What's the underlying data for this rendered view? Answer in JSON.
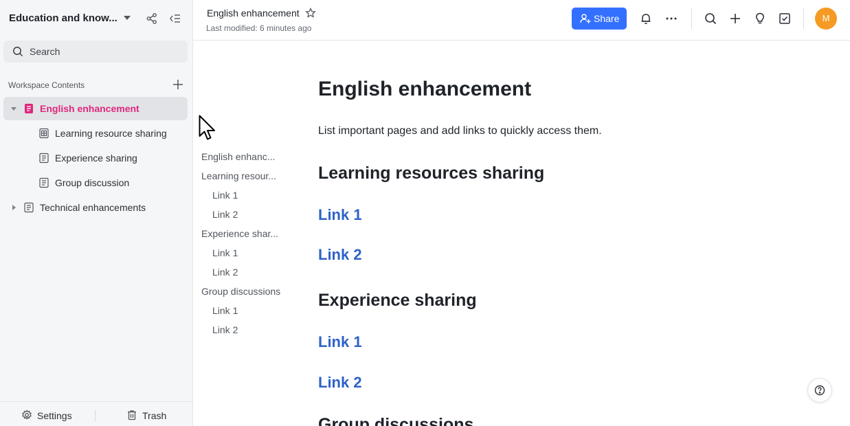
{
  "sidebar": {
    "workspace_title": "Education and know...",
    "search_placeholder": "Search",
    "section_label": "Workspace Contents",
    "items": [
      {
        "label": "English enhancement",
        "active": true
      },
      {
        "label": "Learning resource sharing"
      },
      {
        "label": "Experience sharing"
      },
      {
        "label": "Group discussion"
      },
      {
        "label": "Technical enhancements"
      }
    ],
    "footer": {
      "settings": "Settings",
      "trash": "Trash"
    }
  },
  "topbar": {
    "doc_title": "English enhancement",
    "last_modified": "Last modified: 6 minutes ago",
    "share_label": "Share",
    "avatar_initial": "M"
  },
  "outline": [
    {
      "label": "English enhanc..."
    },
    {
      "label": "Learning resour..."
    },
    {
      "label": "Link 1"
    },
    {
      "label": "Link 2"
    },
    {
      "label": "Experience shar..."
    },
    {
      "label": "Link 1"
    },
    {
      "label": "Link 2"
    },
    {
      "label": "Group discussions"
    },
    {
      "label": "Link 1"
    },
    {
      "label": "Link 2"
    }
  ],
  "document": {
    "title": "English enhancement",
    "intro": "List important pages and add links to quickly access them.",
    "sections": [
      {
        "heading": "Learning resources sharing",
        "links": [
          "Link 1",
          "Link 2"
        ]
      },
      {
        "heading": "Experience sharing",
        "links": [
          "Link 1",
          "Link 2"
        ]
      },
      {
        "heading": "Group discussions"
      }
    ]
  },
  "colors": {
    "accent": "#3370ff",
    "active_item": "#e0267d",
    "link": "#2e62c8",
    "avatar": "#f59b23"
  }
}
